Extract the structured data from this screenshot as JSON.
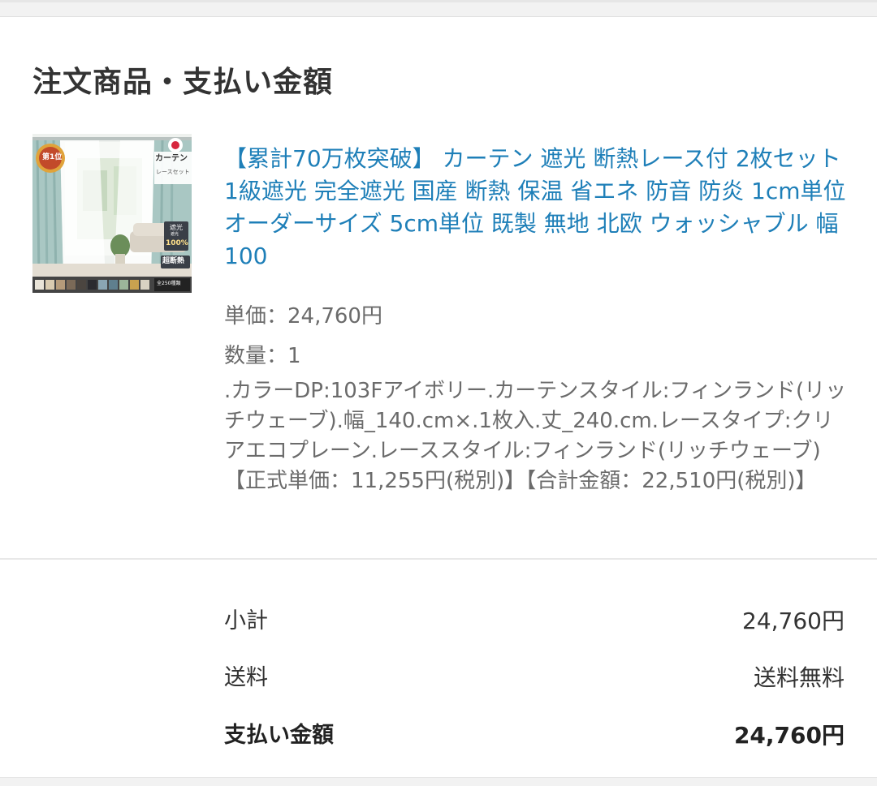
{
  "section": {
    "title": "注文商品・支払い金額"
  },
  "product": {
    "image": {
      "icon": "product-photo",
      "badge_text": "第1位",
      "label_top": "カーテン",
      "label_sub": "レースセット",
      "blackout_label": "遮光",
      "blackout_sub": "遮光",
      "blackout_percent": "100%",
      "insulation_label": "超断熱",
      "colors_label": "全250種類",
      "flag_color": "#d7263d",
      "fabric_color": "#a9c7c3",
      "swatches": [
        "#e9e4d8",
        "#d9cbb0",
        "#b59b7a",
        "#7b6a58",
        "#4b4540",
        "#2b2b30",
        "#8aa5b3",
        "#5f7f8e",
        "#9cb59a",
        "#c9a24f",
        "#d8d2c3"
      ]
    },
    "title": "【累計70万枚突破】 カーテン 遮光 断熱レース付 2枚セット 1級遮光 完全遮光 国産 断熱 保温 省エネ 防音 防炎 1cm単位 オーダーサイズ 5cm単位 既製 無地 北欧 ウォッシャブル 幅100",
    "unit_price": "単価：24,760円",
    "quantity": "数量：1",
    "options": ".カラーDP:103Fアイボリー.カーテンスタイル:フィンランド(リッチウェーブ).幅_140.cm×.1枚入.丈_240.cm.レースタイプ:クリアエコプレーン.レーススタイル:フィンランド(リッチウェーブ)【正式単価：11,255円(税別)】【合計金額：22,510円(税別)】"
  },
  "summary": {
    "subtotal_label": "小計",
    "subtotal_value": "24,760円",
    "shipping_label": "送料",
    "shipping_value": "送料無料",
    "total_label": "支払い金額",
    "total_value": "24,760円"
  },
  "colors": {
    "link": "#1e7fb8",
    "text": "#333333",
    "muted": "#6b6b6b",
    "divider": "#e8e8e8"
  }
}
